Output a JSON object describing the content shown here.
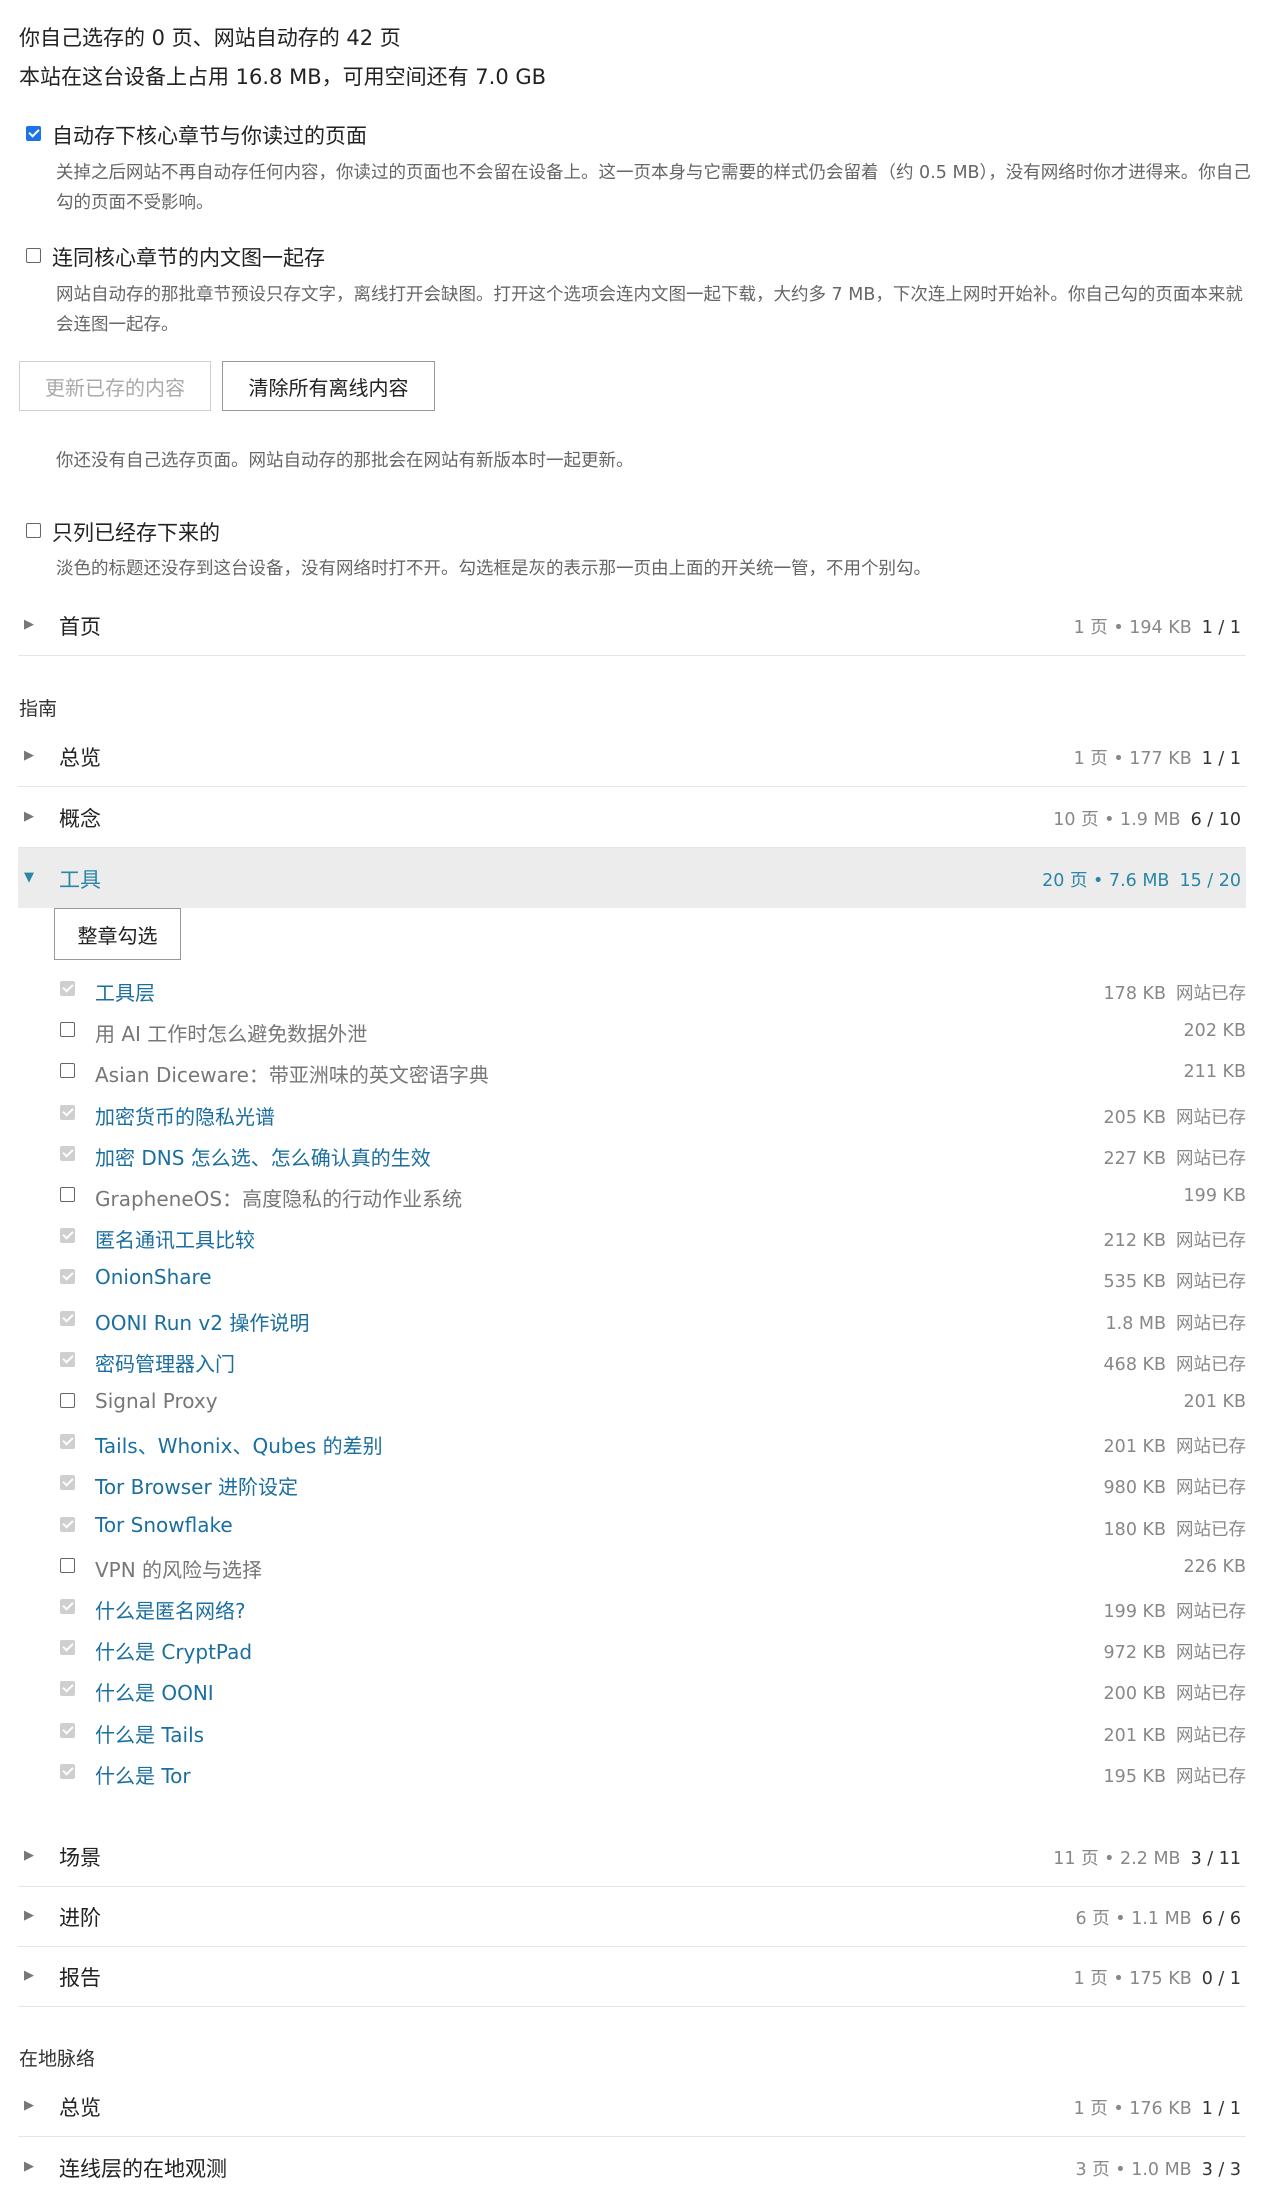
{
  "summary": {
    "line1": "你自己选存的 0 页、网站自动存的 42 页",
    "line2": "本站在这台设备上占用 16.8 MB，可用空间还有 7.0 GB"
  },
  "options": {
    "auto_save": {
      "label": "自动存下核心章节与你读过的页面",
      "checked": true,
      "desc": "关掉之后网站不再自动存任何内容，你读过的页面也不会留在设备上。这一页本身与它需要的样式仍会留着（约 0.5 MB），没有网络时你才进得来。你自己勾的页面不受影响。"
    },
    "with_images": {
      "label": "连同核心章节的内文图一起存",
      "checked": false,
      "desc": "网站自动存的那批章节预设只存文字，离线打开会缺图。打开这个选项会连内文图一起下载，大约多 7 MB，下次连上网时开始补。你自己勾的页面本来就会连图一起存。"
    }
  },
  "buttons": {
    "update": "更新已存的内容",
    "clear": "清除所有离线内容"
  },
  "note": "你还没有自己选存页面。网站自动存的那批会在网站有新版本时一起更新。",
  "filter": {
    "label": "只列已经存下来的",
    "checked": false,
    "desc": "淡色的标题还没存到这台设备，没有网络时打不开。勾选框是灰的表示那一页由上面的开关统一管，不用个别勾。"
  },
  "home": {
    "name": "首页",
    "meta": "1 页 • 194 KB",
    "count": "1 / 1"
  },
  "guide": {
    "title": "指南",
    "sections": [
      {
        "name": "总览",
        "meta": "1 页 • 177 KB",
        "count": "1 / 1"
      },
      {
        "name": "概念",
        "meta": "10 页 • 1.9 MB",
        "count": "6 / 10"
      },
      {
        "name": "工具",
        "meta": "20 页 • 7.6 MB",
        "count": "15 / 20",
        "open": true
      }
    ],
    "select_all": "整章勾选",
    "saved_label": "网站已存",
    "items": [
      {
        "name": "工具层",
        "size": "178 KB",
        "saved": true
      },
      {
        "name": "用 AI 工作时怎么避免数据外泄",
        "size": "202 KB",
        "saved": false
      },
      {
        "name": "Asian Diceware：带亚洲味的英文密语字典",
        "size": "211 KB",
        "saved": false
      },
      {
        "name": "加密货币的隐私光谱",
        "size": "205 KB",
        "saved": true
      },
      {
        "name": "加密 DNS 怎么选、怎么确认真的生效",
        "size": "227 KB",
        "saved": true
      },
      {
        "name": "GrapheneOS：高度隐私的行动作业系统",
        "size": "199 KB",
        "saved": false
      },
      {
        "name": "匿名通讯工具比较",
        "size": "212 KB",
        "saved": true
      },
      {
        "name": "OnionShare",
        "size": "535 KB",
        "saved": true
      },
      {
        "name": "OONI Run v2 操作说明",
        "size": "1.8 MB",
        "saved": true
      },
      {
        "name": "密码管理器入门",
        "size": "468 KB",
        "saved": true
      },
      {
        "name": "Signal Proxy",
        "size": "201 KB",
        "saved": false
      },
      {
        "name": "Tails、Whonix、Qubes 的差别",
        "size": "201 KB",
        "saved": true
      },
      {
        "name": "Tor Browser 进阶设定",
        "size": "980 KB",
        "saved": true
      },
      {
        "name": "Tor Snowflake",
        "size": "180 KB",
        "saved": true
      },
      {
        "name": "VPN 的风险与选择",
        "size": "226 KB",
        "saved": false
      },
      {
        "name": "什么是匿名网络?",
        "size": "199 KB",
        "saved": true
      },
      {
        "name": "什么是 CryptPad",
        "size": "972 KB",
        "saved": true
      },
      {
        "name": "什么是 OONI",
        "size": "200 KB",
        "saved": true
      },
      {
        "name": "什么是 Tails",
        "size": "201 KB",
        "saved": true
      },
      {
        "name": "什么是 Tor",
        "size": "195 KB",
        "saved": true
      }
    ],
    "after": [
      {
        "name": "场景",
        "meta": "11 页 • 2.2 MB",
        "count": "3 / 11"
      },
      {
        "name": "进阶",
        "meta": "6 页 • 1.1 MB",
        "count": "6 / 6"
      },
      {
        "name": "报告",
        "meta": "1 页 • 175 KB",
        "count": "0 / 1"
      }
    ]
  },
  "local": {
    "title": "在地脉络",
    "sections": [
      {
        "name": "总览",
        "meta": "1 页 • 176 KB",
        "count": "1 / 1"
      },
      {
        "name": "连线层的在地观测",
        "meta": "3 页 • 1.0 MB",
        "count": "3 / 3"
      }
    ]
  }
}
